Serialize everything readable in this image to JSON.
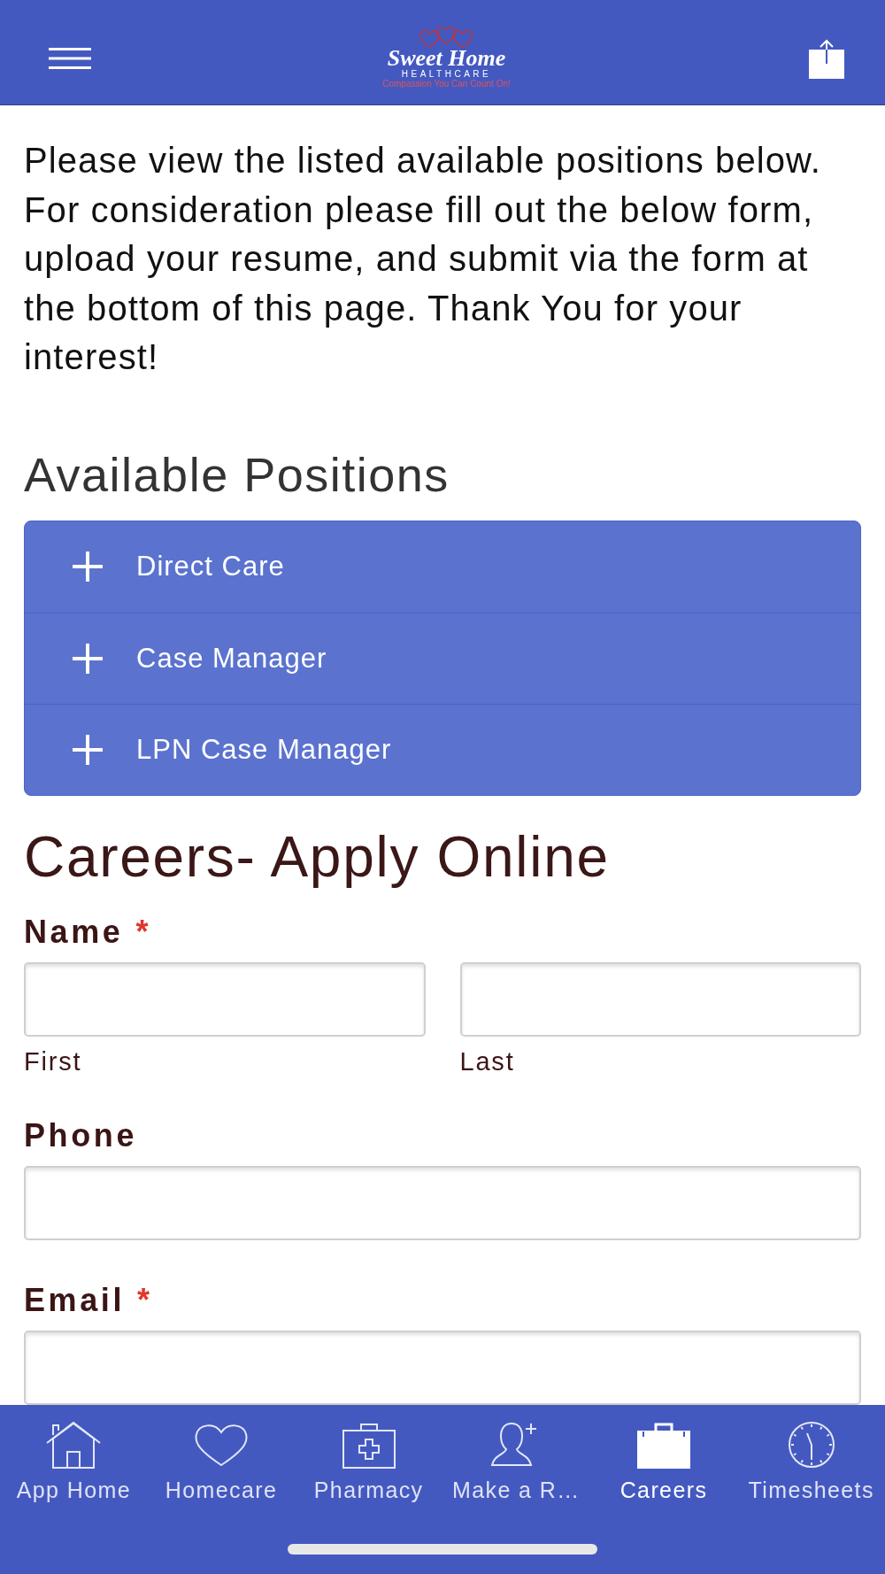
{
  "header": {
    "logo": {
      "name": "Sweet Home",
      "subtitle": "HEALTHCARE",
      "tagline": "Compassion You Can Count On!"
    }
  },
  "intro": "Please view the listed available positions below. For consideration please fill out the below form, upload your resume, and submit via the form at the bottom of this page. Thank You for your interest!",
  "positions": {
    "title": "Available Positions",
    "items": [
      {
        "label": "Direct Care",
        "expanded": false
      },
      {
        "label": "Case Manager",
        "expanded": false
      },
      {
        "label": "LPN Case Manager",
        "expanded": false
      }
    ]
  },
  "form": {
    "title": "Careers- Apply Online",
    "fields": [
      {
        "kind": "split",
        "label": "Name",
        "required_mark": "*",
        "sublabels": [
          "First",
          "Last"
        ]
      },
      {
        "kind": "single",
        "label": "Phone"
      },
      {
        "kind": "single",
        "label": "Email",
        "required_mark": "*"
      }
    ]
  },
  "tab_bar": {
    "tabs": [
      {
        "label": "App Home",
        "selected": false
      },
      {
        "label": "Homecare",
        "selected": false
      },
      {
        "label": "Pharmacy",
        "selected": false
      },
      {
        "label": "Make a R…",
        "selected": false
      },
      {
        "label": "Careers",
        "selected": true
      },
      {
        "label": "Timesheets",
        "selected": false
      }
    ]
  }
}
